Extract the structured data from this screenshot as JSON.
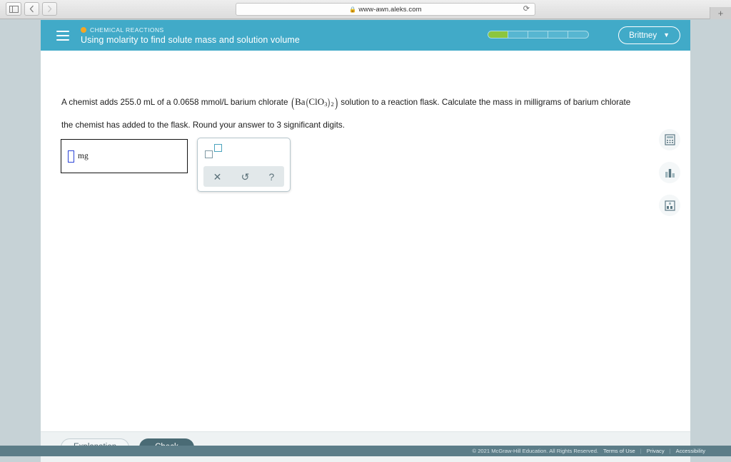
{
  "browser": {
    "sidebar_toggle_icon": "sidebar-panel-icon",
    "back_icon": "chevron-left-icon",
    "forward_icon": "chevron-right-icon",
    "url": "www-awn.aleks.com",
    "lock_icon": "lock-icon",
    "reload_icon": "reload-icon",
    "newtab_label": "+"
  },
  "header": {
    "menu_icon": "hamburger-menu-icon",
    "breadcrumb": "CHEMICAL REACTIONS",
    "title": "Using molarity to find solute mass and solution volume",
    "progress": {
      "segments": 5,
      "filled": 1,
      "fill_color": "#8cc63f"
    },
    "user": {
      "name": "Brittney",
      "chevron": "▼"
    },
    "bar_color": "#41aac8"
  },
  "collapse_tab": {
    "icon": "chevron-down-icon",
    "glyph": "⌄"
  },
  "question": {
    "part1": "A chemist adds 255.0 mL of a 0.0658",
    "part2": "mmol/L barium chlorate",
    "formula": {
      "element": "Ba",
      "group": "ClO",
      "group_sub": "3",
      "outer_sub": "2"
    },
    "part3": "solution to a reaction flask. Calculate the mass in milligrams of barium chlorate",
    "part4": "the chemist has added to the flask. Round your answer to 3 significant digits.",
    "volume": "255.0 mL",
    "concentration": "0.0658 mmol/L",
    "sig_digits": "3"
  },
  "answer": {
    "placeholder_box": "empty-answer-slot",
    "unit": "mg",
    "value": ""
  },
  "tool_panel": {
    "superscript_icon": "exponent-icon",
    "clear_label": "✕",
    "clear_icon": "clear-icon",
    "undo_label": "↺",
    "undo_icon": "undo-icon",
    "help_label": "?",
    "help_icon": "help-icon"
  },
  "rail": {
    "items": [
      {
        "icon": "calculator-icon",
        "name": "calculator"
      },
      {
        "icon": "bar-chart-icon",
        "name": "data-chart"
      },
      {
        "icon": "periodic-table-icon",
        "name": "periodic-table"
      }
    ]
  },
  "actions": {
    "explanation_label": "Explanation",
    "check_label": "Check"
  },
  "footer": {
    "copyright": "© 2021 McGraw-Hill Education. All Rights Reserved.",
    "terms": "Terms of Use",
    "privacy": "Privacy",
    "accessibility": "Accessibility",
    "separator": "|"
  }
}
